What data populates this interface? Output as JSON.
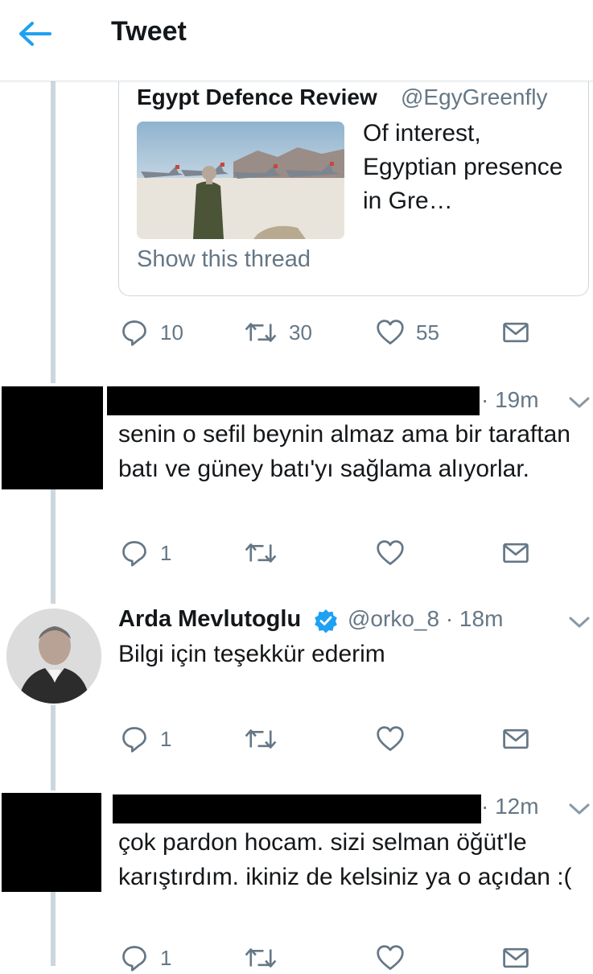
{
  "header": {
    "title": "Tweet"
  },
  "quoted_tweet": {
    "author_name": "Egypt Defence Review",
    "author_handle": "@EgyGreenfly",
    "text": "Of interest, Egyptian presence in Gre…",
    "show_thread": "Show this thread",
    "replies": "10",
    "retweets": "30",
    "likes": "55"
  },
  "replies": [
    {
      "timestamp": "· 19m",
      "text": "senin o sefil beynin almaz ama bir taraftan batı ve güney batı'yı sağlama alıyorlar.",
      "reply_count": "1"
    },
    {
      "author_name": "Arda Mevlutoglu",
      "author_handle": "@orko_8",
      "timestamp": "· 18m",
      "text": "Bilgi için teşekkür ederim",
      "reply_count": "1"
    },
    {
      "timestamp": "· 12m",
      "text": "çok pardon hocam. sizi selman öğüt'le karıştırdım. ikiniz de kelsiniz ya o açıdan :(",
      "reply_count": "1"
    }
  ],
  "colors": {
    "accent": "#1da1f2",
    "muted": "#657786",
    "line": "#ccd6dd"
  },
  "icons": [
    "back-arrow-icon",
    "reply-icon",
    "retweet-icon",
    "like-icon",
    "direct-message-icon",
    "chevron-down-icon",
    "verified-badge-icon"
  ]
}
